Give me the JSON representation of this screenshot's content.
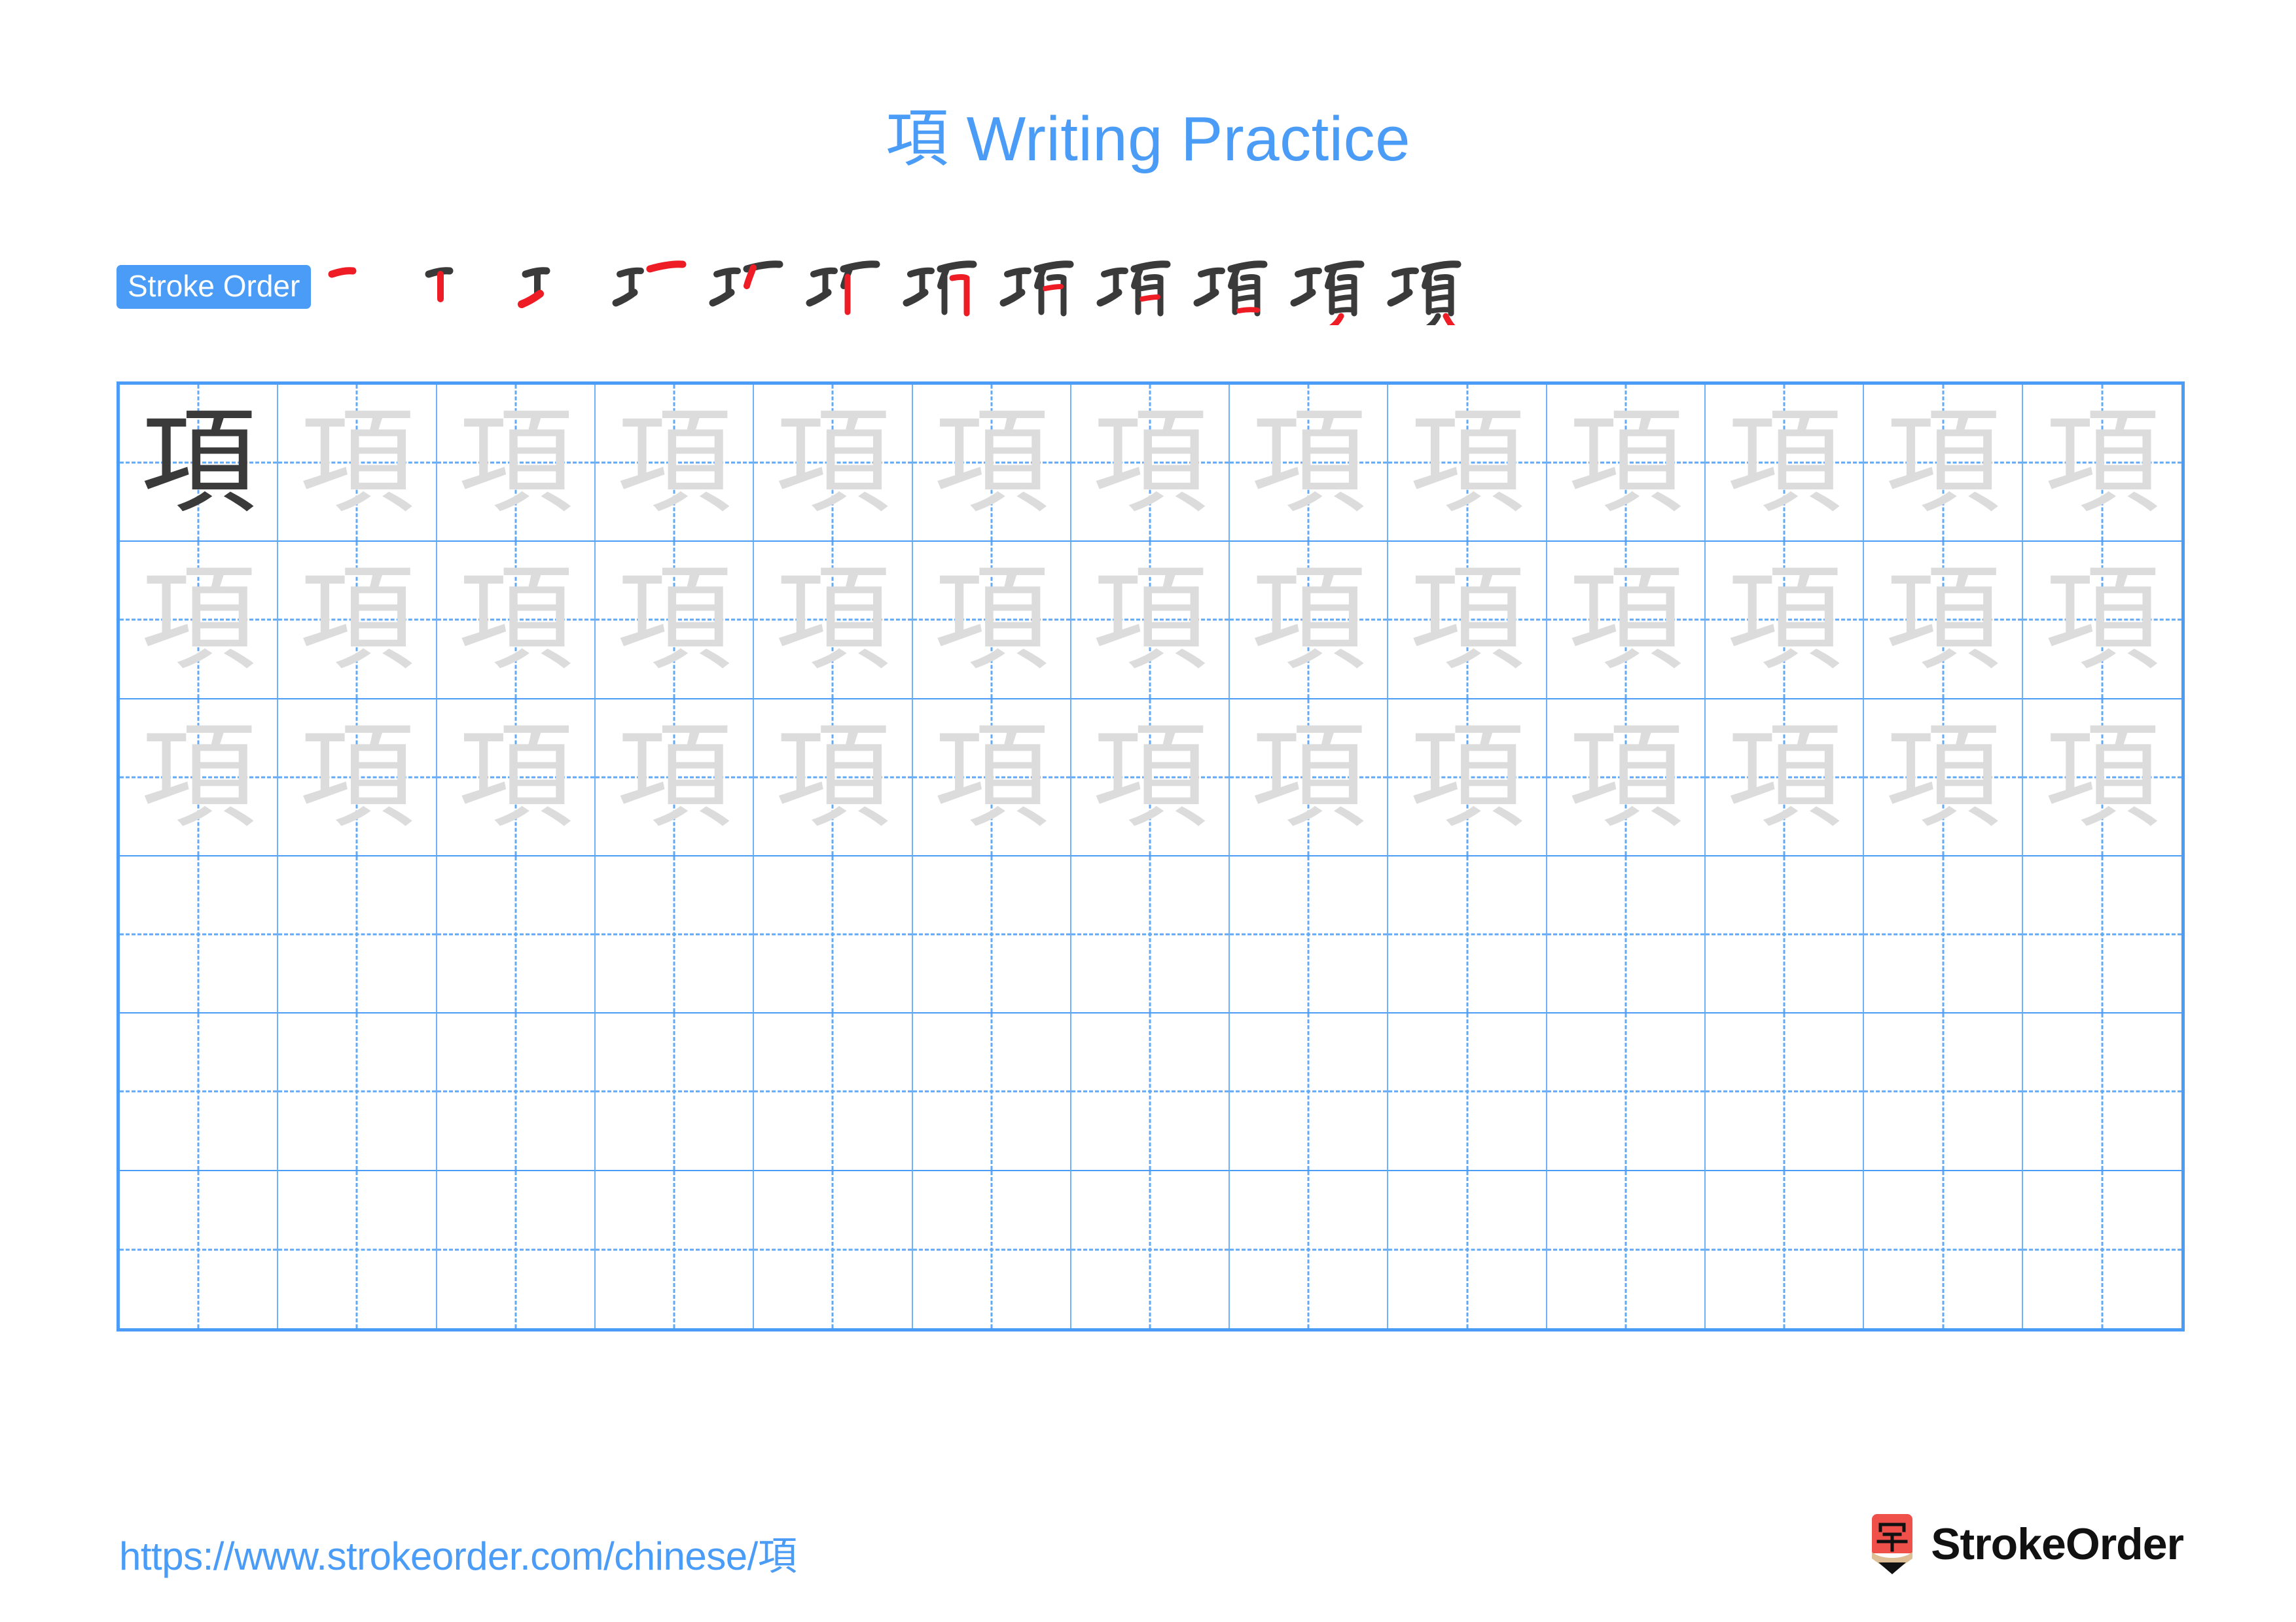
{
  "character": "項",
  "header": {
    "title": "項 Writing Practice",
    "title_character": "項",
    "title_text": " Writing Practice",
    "title_color": "#4a9cf6"
  },
  "stroke_order": {
    "badge_label": "Stroke Order",
    "badge_bg": "#4a9cf6",
    "badge_color": "#ffffff",
    "stroke_count": 12,
    "new_stroke_color": "#ee1c25",
    "existing_stroke_color": "#3a3a3a",
    "steps": [
      {
        "index": 1,
        "label": "一"
      },
      {
        "index": 2,
        "label": "丨"
      },
      {
        "index": 3,
        "label": "工"
      },
      {
        "index": 4,
        "label": "工丆"
      },
      {
        "index": 5,
        "label": "工厂"
      },
      {
        "index": 6,
        "label": "玎"
      },
      {
        "index": 7,
        "label": "玙"
      },
      {
        "index": 8,
        "label": "珎"
      },
      {
        "index": 9,
        "label": "珀"
      },
      {
        "index": 10,
        "label": "項(10)"
      },
      {
        "index": 11,
        "label": "項(11)"
      },
      {
        "index": 12,
        "label": "項"
      }
    ]
  },
  "practice_grid": {
    "rows": 6,
    "columns": 13,
    "border_color": "#4a9cf6",
    "guide_color": "#63aaf6",
    "solid_char_color": "#3a3a3a",
    "trace_char_color": "#dcdcdc",
    "cells": [
      [
        "solid",
        "trace",
        "trace",
        "trace",
        "trace",
        "trace",
        "trace",
        "trace",
        "trace",
        "trace",
        "trace",
        "trace",
        "trace"
      ],
      [
        "trace",
        "trace",
        "trace",
        "trace",
        "trace",
        "trace",
        "trace",
        "trace",
        "trace",
        "trace",
        "trace",
        "trace",
        "trace"
      ],
      [
        "trace",
        "trace",
        "trace",
        "trace",
        "trace",
        "trace",
        "trace",
        "trace",
        "trace",
        "trace",
        "trace",
        "trace",
        "trace"
      ],
      [
        "empty",
        "empty",
        "empty",
        "empty",
        "empty",
        "empty",
        "empty",
        "empty",
        "empty",
        "empty",
        "empty",
        "empty",
        "empty"
      ],
      [
        "empty",
        "empty",
        "empty",
        "empty",
        "empty",
        "empty",
        "empty",
        "empty",
        "empty",
        "empty",
        "empty",
        "empty",
        "empty"
      ],
      [
        "empty",
        "empty",
        "empty",
        "empty",
        "empty",
        "empty",
        "empty",
        "empty",
        "empty",
        "empty",
        "empty",
        "empty",
        "empty"
      ]
    ]
  },
  "footer": {
    "url": "https://www.strokeorder.com/chinese/項",
    "url_color": "#4a9cf6",
    "brand_name": "StrokeOrder",
    "logo_char": "字",
    "logo_body_color": "#f0504a",
    "logo_wood_color": "#ddbe95",
    "logo_tip_color": "#111111"
  }
}
